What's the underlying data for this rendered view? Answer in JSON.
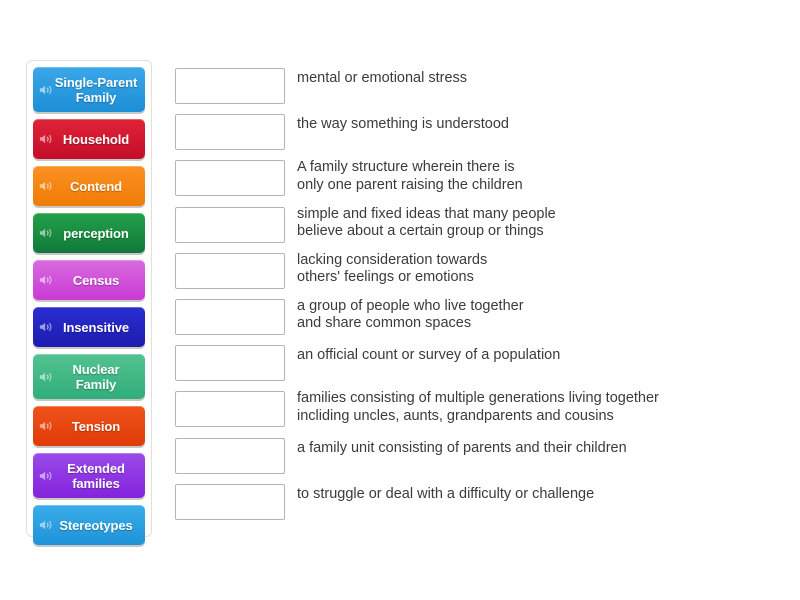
{
  "activity": {
    "type": "match-up",
    "icon_name": "speaker-icon",
    "text_color": "#3b3b3b",
    "box_border_color": "#b5b5b5",
    "panel_border_color": "#e3e0dc"
  },
  "tiles": [
    {
      "label": "Single-Parent\nFamily",
      "color_top": "#3aa7e8",
      "color_bottom": "#1d8fd6",
      "two_line": true
    },
    {
      "label": "Household",
      "color_top": "#e02437",
      "color_bottom": "#c40d2a",
      "two_line": false
    },
    {
      "label": "Contend",
      "color_top": "#fb9121",
      "color_bottom": "#f07c07",
      "two_line": false
    },
    {
      "label": "perception",
      "color_top": "#23a14a",
      "color_bottom": "#11793a",
      "two_line": false
    },
    {
      "label": "Census",
      "color_top": "#d96be0",
      "color_bottom": "#c93ad3",
      "two_line": false
    },
    {
      "label": "Insensitive",
      "color_top": "#2a2ed2",
      "color_bottom": "#1c1cae",
      "two_line": false
    },
    {
      "label": "Nuclear\nFamily",
      "color_top": "#53c291",
      "color_bottom": "#30ae79",
      "two_line": true
    },
    {
      "label": "Tension",
      "color_top": "#f0521b",
      "color_bottom": "#df3b06",
      "two_line": false
    },
    {
      "label": "Extended\nfamilies",
      "color_top": "#9b4ae8",
      "color_bottom": "#8324dd",
      "two_line": true
    },
    {
      "label": "Stereotypes",
      "color_top": "#3aacea",
      "color_bottom": "#1e93d8",
      "two_line": false
    }
  ],
  "rows": [
    {
      "definition": "mental or emotional stress",
      "answer": "",
      "two_line": false
    },
    {
      "definition": "the way something is understood",
      "answer": "",
      "two_line": false
    },
    {
      "definition": "A family structure wherein there is\nonly one parent raising the children",
      "answer": "",
      "two_line": true
    },
    {
      "definition": "simple and fixed ideas that many people\nbelieve about a certain group or things",
      "answer": "",
      "two_line": true
    },
    {
      "definition": "lacking consideration towards\nothers' feelings or emotions",
      "answer": "",
      "two_line": true
    },
    {
      "definition": "a group of people who live together\nand share common spaces",
      "answer": "",
      "two_line": true
    },
    {
      "definition": "an official count or survey of a population",
      "answer": "",
      "two_line": false
    },
    {
      "definition": "families consisting of multiple generations living together\nincliding uncles, aunts, grandparents and cousins",
      "answer": "",
      "two_line": true
    },
    {
      "definition": "a family unit consisting of parents and their children",
      "answer": "",
      "two_line": false
    },
    {
      "definition": "to struggle or deal with a difficulty or challenge",
      "answer": "",
      "two_line": false
    }
  ]
}
